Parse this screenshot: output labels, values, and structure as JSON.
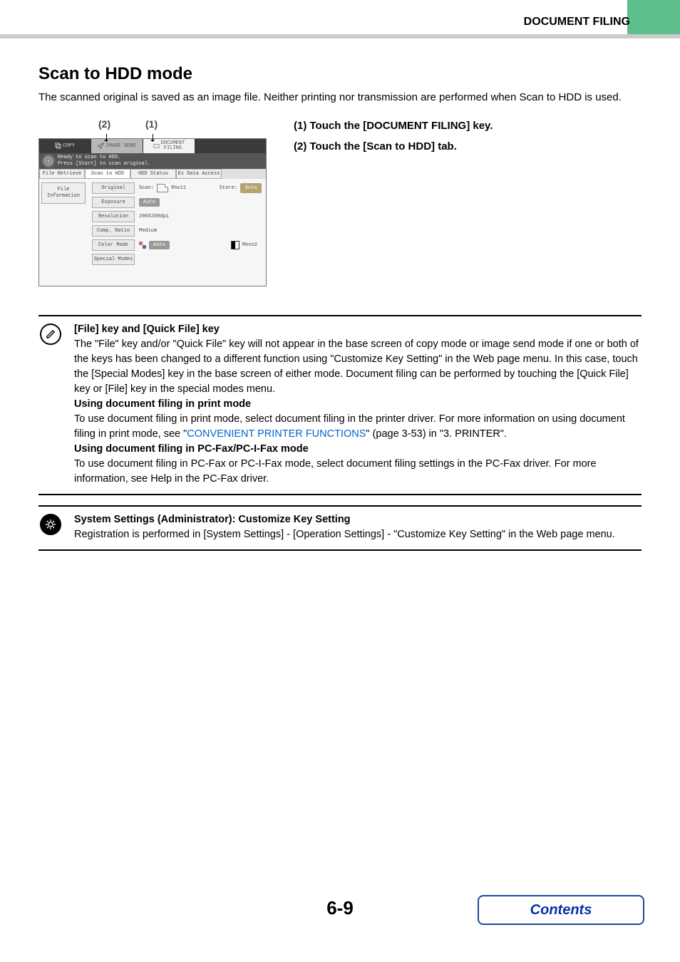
{
  "header": {
    "right_title": "DOCUMENT FILING"
  },
  "heading": "Scan to HDD mode",
  "intro": "The scanned original is saved as an image file. Neither printing nor transmission are performed when Scan to HDD is used.",
  "callouts": {
    "c1": "(1)",
    "c2": "(2)"
  },
  "mock": {
    "tabs": {
      "copy": "COPY",
      "image_send": "IMAGE SEND",
      "doc_filing_l1": "DOCUMENT",
      "doc_filing_l2": "FILING"
    },
    "status": {
      "line1": "Ready to scan to HDD.",
      "line2": "Press [Start] to scan original."
    },
    "subtabs": {
      "file_retrieve": "File Retrieve",
      "scan_to_hdd": "Scan to HDD",
      "hdd_status": "HDD Status",
      "ex_data": "Ex Data Access"
    },
    "left": {
      "file_info_l1": "File",
      "file_info_l2": "Information"
    },
    "rows": {
      "original": {
        "btn": "Original",
        "scan_lbl": "Scan:",
        "scan_val": "8½x11",
        "store_lbl": "Store:",
        "store_btn": "Auto"
      },
      "exposure": {
        "btn": "Exposure",
        "val": "Auto"
      },
      "resolution": {
        "btn": "Resolution",
        "val": "200X200dpi"
      },
      "comp": {
        "btn": "Comp. Ratio",
        "val": "Medium"
      },
      "color": {
        "btn": "Color Mode",
        "auto": "Auto",
        "mono": "Mono2"
      },
      "special": {
        "btn": "Special Modes"
      }
    }
  },
  "steps": {
    "s1": "(1)   Touch the [DOCUMENT FILING] key.",
    "s2": "(2)   Touch the [Scan to HDD] tab."
  },
  "note1": {
    "h1": "[File] key and [Quick File] key",
    "p1a": "The \"File\" key and/or \"Quick File\" key will not appear in the base screen of copy mode or image send mode if one or both of the keys has been changed to a different function using \"Customize Key Setting\" in the Web page menu. In this case, touch the [Special Modes] key in the base screen of either mode. Document filing can be performed by touching the [Quick File] key or [File] key in the special modes menu.",
    "h2": "Using document filing in print mode",
    "p2a": "To use document filing in print mode, select document filing in the printer driver. For more information on using document filing in print mode, see \"",
    "p2link": "CONVENIENT PRINTER FUNCTIONS",
    "p2b": "\" (page 3-53) in \"3. PRINTER\".",
    "h3": "Using document filing in PC-Fax/PC-I-Fax mode",
    "p3": "To use document filing in PC-Fax or PC-I-Fax mode, select document filing settings in the PC-Fax driver. For more information, see Help in the PC-Fax driver."
  },
  "note2": {
    "h": "System Settings (Administrator): Customize Key Setting",
    "p": "Registration is performed in [System Settings] - [Operation Settings] - \"Customize Key Setting\" in the Web page menu."
  },
  "footer": {
    "page": "6-9",
    "contents": "Contents"
  }
}
